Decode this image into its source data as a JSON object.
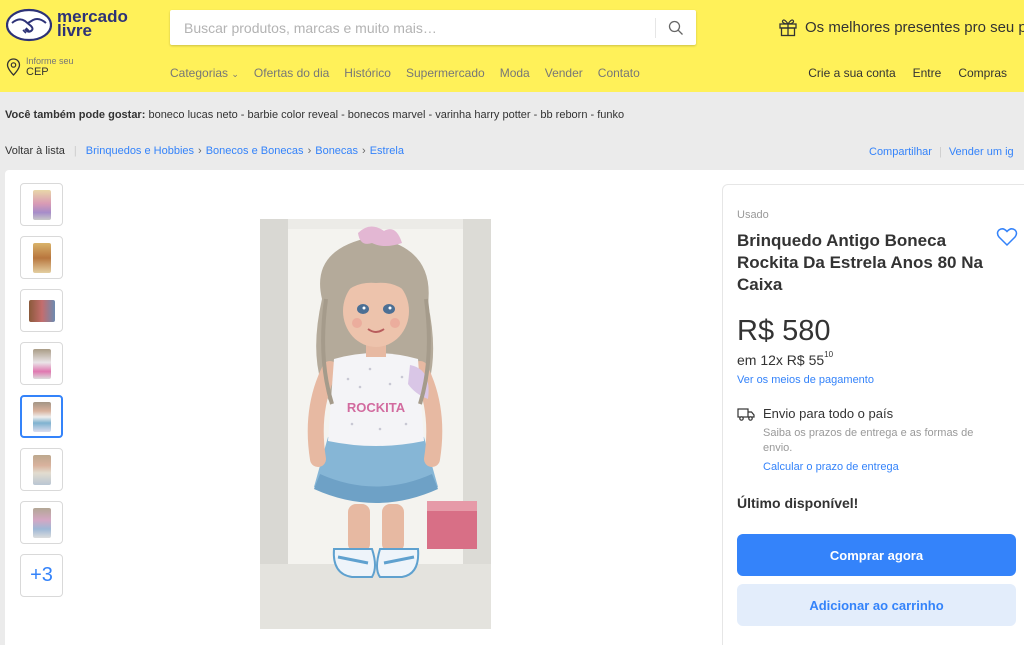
{
  "header": {
    "logo_text": "mercado livre",
    "logo_line1": "mercado",
    "logo_line2": "livre",
    "search_placeholder": "Buscar produtos, marcas e muito mais…",
    "promo_text": "Os melhores presentes pro seu p",
    "location": {
      "line1": "Informe seu",
      "line2": "CEP"
    },
    "nav": [
      "Categorias",
      "Ofertas do dia",
      "Histórico",
      "Supermercado",
      "Moda",
      "Vender",
      "Contato"
    ],
    "user_nav": [
      "Crie a sua conta",
      "Entre",
      "Compras"
    ],
    "colors": {
      "brand_yellow": "#fff159",
      "brand_blue": "#2d3277",
      "accent": "#3483fa"
    }
  },
  "suggestions": {
    "label": "Você também pode gostar:",
    "items": "boneco lucas neto - barbie color reveal - bonecos marvel - varinha harry potter - bb reborn - funko"
  },
  "breadcrumb": {
    "back": "Voltar à lista",
    "items": [
      "Brinquedos e Hobbies",
      "Bonecos e Bonecas",
      "Bonecas",
      "Estrela"
    ],
    "share": "Compartilhar",
    "sell": "Vender um ig"
  },
  "gallery": {
    "selected_index": 4,
    "more_label": "+3",
    "thumb_count": 7
  },
  "product": {
    "condition": "Usado",
    "title": "Brinquedo Antigo Boneca Rockita Da Estrela Anos 80 Na Caixa",
    "price": "R$ 580",
    "installments_prefix": "em 12x R$ 55",
    "installments_cents": "10",
    "payment_link": "Ver os meios de pagamento",
    "shipping_title": "Envio para todo o país",
    "shipping_sub": "Saiba os prazos de entrega e as formas de envio.",
    "shipping_link": "Calcular o prazo de entrega",
    "stock": "Último disponível!",
    "buy_label": "Comprar agora",
    "cart_label": "Adicionar ao carrinho",
    "doll_shirt_text": "ROCKITA"
  }
}
